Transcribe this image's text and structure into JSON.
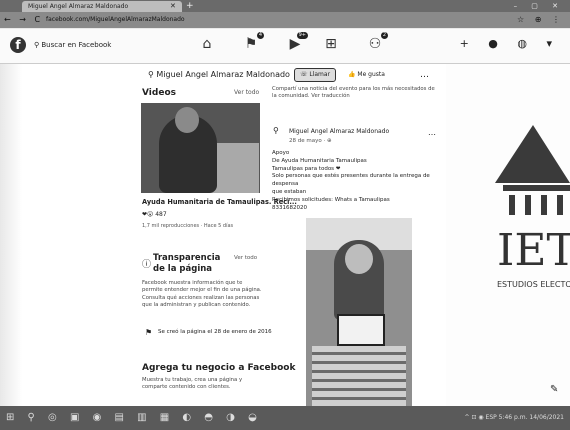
{
  "browser": {
    "tab_title": "Miguel Angel Almaraz Maldonado",
    "tab_close": "✕",
    "new_tab": "+",
    "window_controls": "–  ▢  ✕",
    "nav_buttons": "← → C",
    "url": "facebook.com/MiguelAngelAlmarazMaldonado",
    "address_right": "☆ ⊕ ⋮"
  },
  "fb_header": {
    "logo": "f",
    "search_placeholder": "Buscar en Facebook",
    "nav_icons": [
      {
        "name": "home-icon",
        "glyph": "⌂",
        "badge": ""
      },
      {
        "name": "flag-icon",
        "glyph": "⚑",
        "badge": "4"
      },
      {
        "name": "watch-icon",
        "glyph": "▶",
        "badge": "9+"
      },
      {
        "name": "marketplace-icon",
        "glyph": "⊞",
        "badge": ""
      },
      {
        "name": "groups-icon",
        "glyph": "⚇",
        "badge": "2"
      }
    ],
    "right_icons": "+ ● ◍ ▾"
  },
  "profile_bar": {
    "name": "Miguel Angel Almaraz Maldonado",
    "action_button": "Llamar",
    "like_button": "Me gusta",
    "more": "…"
  },
  "videos": {
    "title": "Videos",
    "see_all": "Ver todo",
    "caption": "Ayuda Humanitaria de Tamaulipas. Reci...",
    "reactions": "487",
    "views": "1,7 mil reproducciones · Hace 5 días"
  },
  "transparency": {
    "title": "Transparencia de la página",
    "see_all": "Ver todo",
    "body": "Facebook muestra información que te permite entender mejor el fin de una página. Consulta qué acciones realizan las personas que la administran y publican contenido.",
    "created": "Se creó la página el 28 de enero de 2016"
  },
  "business": {
    "title": "Agrega tu negocio a Facebook",
    "body": "Muestra tu trabajo, crea una página y comparte contenido con clientes."
  },
  "feed": {
    "top_text": "Compartí una noticia del evento para los más necesitados de la comunidad. Ver traducción",
    "post_name": "Miguel Angel Almaraz Maldonado",
    "post_date": "28 de mayo · ⊕",
    "post_lines": [
      "Apoyo",
      "De Ayuda Humanitaria Tamaulipas",
      "Tamaulipas para todos ❤",
      "Solo personas que estés presentes durante la entrega de despensa",
      "que estaban",
      "Recibimos solicitudes: Whats a Tamaulipas",
      "8331682020"
    ],
    "post_dots": "…"
  },
  "side_logo": {
    "letters": "IET",
    "subtitle": "ESTUDIOS ELECTO"
  },
  "taskbar": {
    "icons": "⊞ ⚲ ◎ ▣ ◉ ▤ ▥ ▦ ◐ ◓ ◑ ◒",
    "tray": "^ ⊡ ◉ ESP  5:46 p.m.  14/06/2021"
  },
  "colors": {
    "header_bg": "#fafafa",
    "page_bg": "#ffffff",
    "taskbar_bg": "#5a5a5a"
  }
}
